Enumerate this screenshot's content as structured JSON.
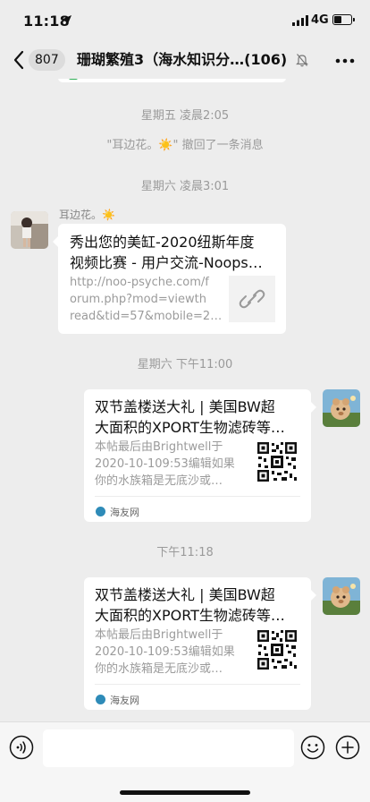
{
  "status_bar": {
    "time": "11:18",
    "network": "4G",
    "battery_level": 0.45
  },
  "nav": {
    "back_count": "807",
    "title": "珊瑚繁殖3（海水知识分…(106)"
  },
  "messages": {
    "time_1": "星期五 凌晨2:05",
    "recall_notice": "\"耳边花。☀️\" 撤回了一条消息",
    "time_2": "星期六 凌晨3:01",
    "sender_name": "耳边花。☀️",
    "link_card": {
      "title": "秀出您的美缸-2020纽斯年度\n视频比赛 - 用户交流-Noops…",
      "url": "http://noo-psyche.com/f\norum.php?mod=viewth\nread&tid=57&mobile=2…"
    },
    "time_3": "星期六 下午11:00",
    "article_card_1": {
      "title": "双节盖楼送大礼 | 美国BW超\n大面积的XPORT生物滤砖等…",
      "desc": "本帖最后由Brightwell于\n2020-10-109:53编辑如果\n你的水族箱是无底沙或…",
      "source": "海友网"
    },
    "time_4": "下午11:18",
    "article_card_2": {
      "title": "双节盖楼送大礼 | 美国BW超\n大面积的XPORT生物滤砖等…",
      "desc": "本帖最后由Brightwell于\n2020-10-109:53编辑如果\n你的水族箱是无底沙或…",
      "source": "海友网"
    }
  },
  "input_bar": {
    "placeholder": ""
  },
  "colors": {
    "background": "#ededed",
    "bubble": "#ffffff",
    "system_text": "#9a9a9a",
    "source_icon": "#2e8bb8"
  }
}
